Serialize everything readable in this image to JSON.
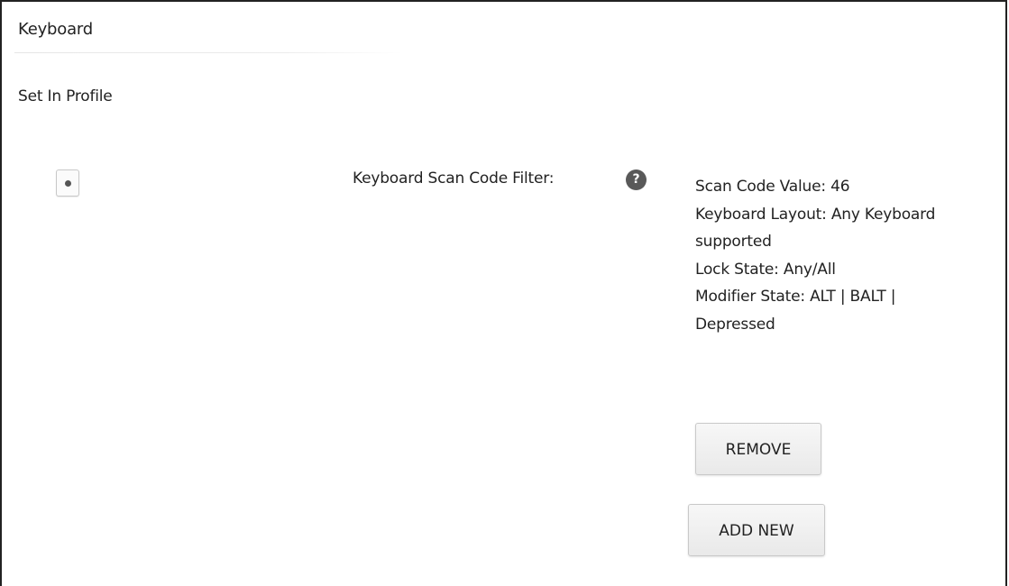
{
  "section": {
    "title": "Keyboard",
    "subtitle": "Set In Profile"
  },
  "filter": {
    "selected": true,
    "label": "Keyboard Scan Code Filter:",
    "help_icon": "help-icon",
    "help_glyph": "?",
    "details": [
      "Scan Code Value: 46",
      "Keyboard Layout: Any Keyboard",
      "supported",
      "Lock State: Any/All",
      "Modifier State: ALT | BALT |",
      "Depressed"
    ]
  },
  "actions": {
    "remove_label": "REMOVE",
    "add_new_label": "ADD NEW"
  },
  "colors": {
    "border": "#222222",
    "help_icon_bg": "#595959",
    "button_bg": "#eeeeee"
  }
}
